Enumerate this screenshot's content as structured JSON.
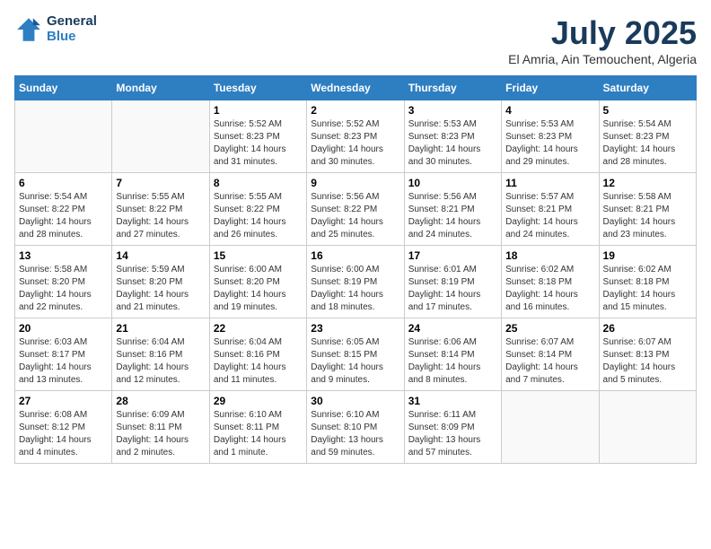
{
  "logo": {
    "line1": "General",
    "line2": "Blue"
  },
  "title": "July 2025",
  "location": "El Amria, Ain Temouchent, Algeria",
  "weekdays": [
    "Sunday",
    "Monday",
    "Tuesday",
    "Wednesday",
    "Thursday",
    "Friday",
    "Saturday"
  ],
  "weeks": [
    [
      {
        "day": "",
        "empty": true
      },
      {
        "day": "",
        "empty": true
      },
      {
        "day": "1",
        "sunrise": "5:52 AM",
        "sunset": "8:23 PM",
        "daylight": "14 hours and 31 minutes."
      },
      {
        "day": "2",
        "sunrise": "5:52 AM",
        "sunset": "8:23 PM",
        "daylight": "14 hours and 30 minutes."
      },
      {
        "day": "3",
        "sunrise": "5:53 AM",
        "sunset": "8:23 PM",
        "daylight": "14 hours and 30 minutes."
      },
      {
        "day": "4",
        "sunrise": "5:53 AM",
        "sunset": "8:23 PM",
        "daylight": "14 hours and 29 minutes."
      },
      {
        "day": "5",
        "sunrise": "5:54 AM",
        "sunset": "8:23 PM",
        "daylight": "14 hours and 28 minutes."
      }
    ],
    [
      {
        "day": "6",
        "sunrise": "5:54 AM",
        "sunset": "8:22 PM",
        "daylight": "14 hours and 28 minutes."
      },
      {
        "day": "7",
        "sunrise": "5:55 AM",
        "sunset": "8:22 PM",
        "daylight": "14 hours and 27 minutes."
      },
      {
        "day": "8",
        "sunrise": "5:55 AM",
        "sunset": "8:22 PM",
        "daylight": "14 hours and 26 minutes."
      },
      {
        "day": "9",
        "sunrise": "5:56 AM",
        "sunset": "8:22 PM",
        "daylight": "14 hours and 25 minutes."
      },
      {
        "day": "10",
        "sunrise": "5:56 AM",
        "sunset": "8:21 PM",
        "daylight": "14 hours and 24 minutes."
      },
      {
        "day": "11",
        "sunrise": "5:57 AM",
        "sunset": "8:21 PM",
        "daylight": "14 hours and 24 minutes."
      },
      {
        "day": "12",
        "sunrise": "5:58 AM",
        "sunset": "8:21 PM",
        "daylight": "14 hours and 23 minutes."
      }
    ],
    [
      {
        "day": "13",
        "sunrise": "5:58 AM",
        "sunset": "8:20 PM",
        "daylight": "14 hours and 22 minutes."
      },
      {
        "day": "14",
        "sunrise": "5:59 AM",
        "sunset": "8:20 PM",
        "daylight": "14 hours and 21 minutes."
      },
      {
        "day": "15",
        "sunrise": "6:00 AM",
        "sunset": "8:20 PM",
        "daylight": "14 hours and 19 minutes."
      },
      {
        "day": "16",
        "sunrise": "6:00 AM",
        "sunset": "8:19 PM",
        "daylight": "14 hours and 18 minutes."
      },
      {
        "day": "17",
        "sunrise": "6:01 AM",
        "sunset": "8:19 PM",
        "daylight": "14 hours and 17 minutes."
      },
      {
        "day": "18",
        "sunrise": "6:02 AM",
        "sunset": "8:18 PM",
        "daylight": "14 hours and 16 minutes."
      },
      {
        "day": "19",
        "sunrise": "6:02 AM",
        "sunset": "8:18 PM",
        "daylight": "14 hours and 15 minutes."
      }
    ],
    [
      {
        "day": "20",
        "sunrise": "6:03 AM",
        "sunset": "8:17 PM",
        "daylight": "14 hours and 13 minutes."
      },
      {
        "day": "21",
        "sunrise": "6:04 AM",
        "sunset": "8:16 PM",
        "daylight": "14 hours and 12 minutes."
      },
      {
        "day": "22",
        "sunrise": "6:04 AM",
        "sunset": "8:16 PM",
        "daylight": "14 hours and 11 minutes."
      },
      {
        "day": "23",
        "sunrise": "6:05 AM",
        "sunset": "8:15 PM",
        "daylight": "14 hours and 9 minutes."
      },
      {
        "day": "24",
        "sunrise": "6:06 AM",
        "sunset": "8:14 PM",
        "daylight": "14 hours and 8 minutes."
      },
      {
        "day": "25",
        "sunrise": "6:07 AM",
        "sunset": "8:14 PM",
        "daylight": "14 hours and 7 minutes."
      },
      {
        "day": "26",
        "sunrise": "6:07 AM",
        "sunset": "8:13 PM",
        "daylight": "14 hours and 5 minutes."
      }
    ],
    [
      {
        "day": "27",
        "sunrise": "6:08 AM",
        "sunset": "8:12 PM",
        "daylight": "14 hours and 4 minutes."
      },
      {
        "day": "28",
        "sunrise": "6:09 AM",
        "sunset": "8:11 PM",
        "daylight": "14 hours and 2 minutes."
      },
      {
        "day": "29",
        "sunrise": "6:10 AM",
        "sunset": "8:11 PM",
        "daylight": "14 hours and 1 minute."
      },
      {
        "day": "30",
        "sunrise": "6:10 AM",
        "sunset": "8:10 PM",
        "daylight": "13 hours and 59 minutes."
      },
      {
        "day": "31",
        "sunrise": "6:11 AM",
        "sunset": "8:09 PM",
        "daylight": "13 hours and 57 minutes."
      },
      {
        "day": "",
        "empty": true
      },
      {
        "day": "",
        "empty": true
      }
    ]
  ]
}
